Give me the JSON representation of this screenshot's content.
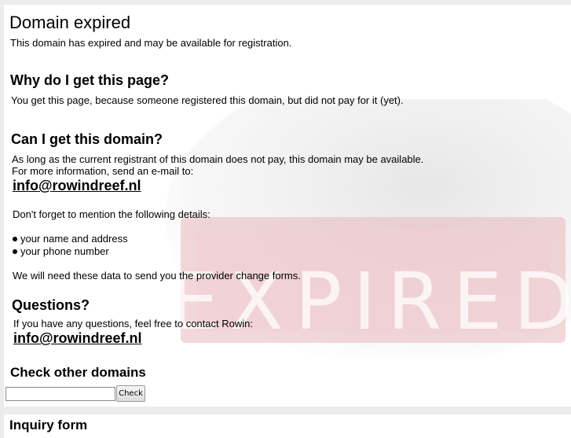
{
  "main": {
    "title": "Domain expired",
    "intro": "This domain has expired and may be available for registration.",
    "why_heading": "Why do I get this page?",
    "why_text": "You get this page, because someone registered this domain, but did not pay for it (yet).",
    "can_heading": "Can I get this domain?",
    "can_text_1": "As long as the current registrant of this domain does not pay, this domain may be available.",
    "can_text_2": "For more information, send an e-mail to:",
    "email_1": "info@rowindreef.nl",
    "details_intro": "Don't forget to mention the following details:",
    "details": [
      "your name and address",
      "your phone number"
    ],
    "forms_text": "We will need these data to send you the provider change forms.",
    "questions_heading": "Questions?",
    "questions_text": "If you have any questions, feel free to contact Rowin:",
    "email_2": "info@rowindreef.nl"
  },
  "check": {
    "heading": "Check other domains",
    "input_value": "",
    "button_label": "Check"
  },
  "inquiry": {
    "heading": "Inquiry form"
  },
  "watermark": {
    "text": "EXPIRED",
    "color": "#e5a3a8"
  }
}
